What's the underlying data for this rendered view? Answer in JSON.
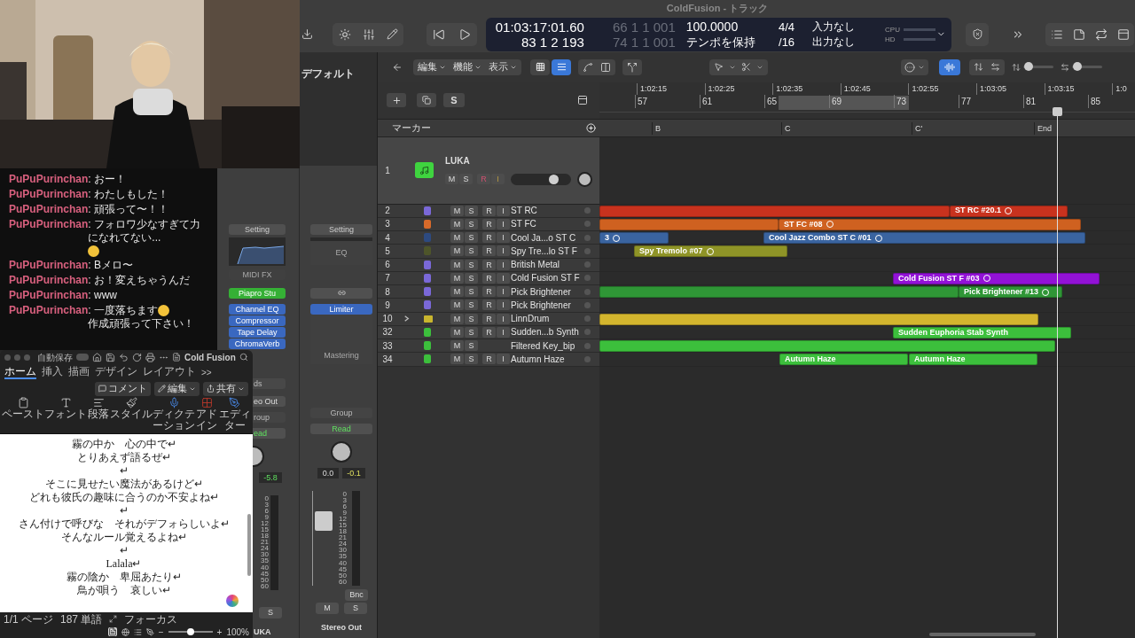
{
  "chat": {
    "messages": [
      {
        "user": "PuPuPurinchan",
        "parts": [
          {
            "kind": "text",
            "text": ": おー！"
          }
        ]
      },
      {
        "user": "PuPuPurinchan",
        "parts": [
          {
            "kind": "text",
            "text": ": わたしもした！"
          }
        ]
      },
      {
        "user": "PuPuPurinchan",
        "parts": [
          {
            "kind": "text",
            "text": ": 頑張って〜！！"
          }
        ]
      },
      {
        "user": "PuPuPurinchan",
        "parts": [
          {
            "kind": "text",
            "text": ": フォロワ少なすぎて力になれてない..."
          },
          {
            "kind": "emoji"
          }
        ]
      },
      {
        "user": "PuPuPurinchan",
        "parts": [
          {
            "kind": "text",
            "text": ": Bメロ〜"
          }
        ]
      },
      {
        "user": "PuPuPurinchan",
        "parts": [
          {
            "kind": "text",
            "text": ": お！変えちゃうんだ"
          }
        ]
      },
      {
        "user": "PuPuPurinchan",
        "parts": [
          {
            "kind": "text",
            "text": ": www"
          }
        ]
      },
      {
        "user": "PuPuPurinchan",
        "parts": [
          {
            "kind": "text",
            "text": ": 一度落ちます"
          },
          {
            "kind": "emoji"
          },
          {
            "kind": "text",
            "text": "作成頑張って下さい！"
          }
        ]
      }
    ]
  },
  "word": {
    "autosave": "自動保存",
    "autosave_toggle": {
      "on": false
    },
    "title": "Cold Fusion",
    "tabs": [
      {
        "label": "ホーム",
        "selected": true
      },
      {
        "label": "挿入",
        "selected": false
      },
      {
        "label": "描画",
        "selected": false
      },
      {
        "label": "デザイン",
        "selected": false
      },
      {
        "label": "レイアウト",
        "selected": false
      }
    ],
    "more": ">>",
    "actions": [
      "コメント",
      "編集",
      "共有"
    ],
    "ribbon": [
      "ペースト",
      "フォント",
      "段落",
      "スタイル",
      "ディクテーション",
      "アドイン",
      "エディター"
    ],
    "lines": [
      "霧の中か　心の中で↵",
      "とりあえず語るぜ↵",
      "↵",
      "そこに見せたい魔法があるけど↵",
      "どれも彼氏の趣味に合うのか不安よね↵",
      "↵",
      "さん付けで呼びな　それがデフォらしいよ↵",
      "そんなルール覚えるよね↵",
      "↵",
      "Lalala↵",
      "霧の陰か　卑屈あたり↵",
      "鳥が唄う　哀しい↵"
    ],
    "status": {
      "page": "1/1 ページ",
      "words": "187 単語",
      "focus": "フォーカス",
      "layouts": [
        {
          "selected": true
        },
        {
          "selected": false
        },
        {
          "selected": false
        },
        {
          "selected": false
        }
      ],
      "zoom_out": "−",
      "zoom_in": "+",
      "zoom": {
        "level": 0.5
      },
      "zoom_text": "100%"
    }
  },
  "logic": {
    "title": "ColdFusion - トラック",
    "lcd": {
      "time": "01:03:17:01.60",
      "position": "83 1 2 193",
      "ghost_1": "66 1 1 001",
      "ghost_2": "74 1 1 001",
      "tempo": "100.0000",
      "tempo_mode": "テンポを保持",
      "signature": "4/4",
      "division": "/16",
      "input": "入力なし",
      "output": "出力なし",
      "cpu": "CPU",
      "hd": "HD"
    },
    "inspector_title": "デフォルト",
    "menus": [
      "編集",
      "機能",
      "表示"
    ],
    "view_buttons": [
      {
        "selected": false
      },
      {
        "selected": true
      }
    ],
    "waveform_zoom": {
      "on": true
    },
    "vertical_zoom": {
      "level": 0.05
    },
    "horizontal_zoom": {
      "level": 0.05
    },
    "header_solo": "S",
    "marker_label": "マーカー",
    "ruler": {
      "times": [
        "1:02:15",
        "1:02:25",
        "1:02:35",
        "1:02:45",
        "1:02:55",
        "1:03:05",
        "1:03:15",
        "1:0"
      ],
      "bars": [
        "57",
        "61",
        "65",
        "69",
        "73",
        "77",
        "81",
        "85"
      ]
    },
    "markers": [
      "B",
      "C",
      "C'",
      "End"
    ],
    "tracks": [
      {
        "number": "1",
        "name": "LUKA",
        "kind": "main",
        "color": "#3fd43f",
        "buttons": [
          "M",
          "S",
          "R",
          "I"
        ],
        "level": 0.75
      },
      {
        "number": "2",
        "name": "ST RC",
        "kind": "track",
        "color": "#7a68d8",
        "buttons": [
          "M",
          "S",
          "R",
          "I"
        ],
        "regions": [
          {
            "color": "#c8321e",
            "looped": false
          },
          {
            "color": "#c8321e",
            "label": "ST RC #20.1",
            "looped": true
          }
        ]
      },
      {
        "number": "3",
        "name": "ST FC",
        "kind": "track",
        "color": "#d86a2a",
        "buttons": [
          "M",
          "S",
          "R",
          "I"
        ],
        "regions": [
          {
            "color": "#cf6120",
            "looped": false
          },
          {
            "color": "#cf6120",
            "label": "ST FC #08",
            "looped": true
          }
        ]
      },
      {
        "number": "4",
        "name": "Cool Ja...o ST C",
        "kind": "track",
        "color": "#2d4a80",
        "buttons": [
          "M",
          "S",
          "R",
          "I"
        ],
        "regions": [
          {
            "color": "#3a64a0",
            "label": "3",
            "looped": true
          },
          {
            "color": "#3a64a0",
            "label": "Cool Jazz Combo ST C #01",
            "looped": true
          }
        ]
      },
      {
        "number": "5",
        "name": "Spy Tre...lo ST F",
        "kind": "track",
        "color": "#4e552a",
        "buttons": [
          "M",
          "S",
          "R",
          "I"
        ],
        "regions": [
          {
            "color": "#8f9427",
            "label": "Spy Tremolo #07",
            "looped": true
          }
        ]
      },
      {
        "number": "6",
        "name": "British Metal",
        "kind": "track",
        "color": "#7a68d8",
        "buttons": [
          "M",
          "S",
          "R",
          "I"
        ]
      },
      {
        "number": "7",
        "name": "Cold Fusion ST F",
        "kind": "track",
        "color": "#7a68d8",
        "buttons": [
          "M",
          "S",
          "R",
          "I"
        ],
        "regions": [
          {
            "color": "#9212d6",
            "label": "Cold Fusion ST F #03",
            "looped": true
          }
        ]
      },
      {
        "number": "8",
        "name": "Pick Brightener",
        "kind": "track",
        "color": "#7a68d8",
        "buttons": [
          "M",
          "S",
          "R",
          "I"
        ],
        "regions": [
          {
            "color": "#2f9636",
            "looped": false
          },
          {
            "color": "#2f9636",
            "label": "Pick Brightener #13",
            "looped": true
          }
        ]
      },
      {
        "number": "9",
        "name": "Pick Brightener",
        "kind": "track",
        "color": "#7a68d8",
        "buttons": [
          "M",
          "S",
          "R",
          "I"
        ]
      },
      {
        "number": "10",
        "name": "LinnDrum",
        "kind": "stack",
        "expanded": false,
        "color": "#c8b52e",
        "buttons": [
          "M",
          "S",
          "R",
          "I"
        ],
        "regions": [
          {
            "color": "#d3b52e",
            "looped": false
          }
        ]
      },
      {
        "number": "32",
        "name": "Sudden...b Synth",
        "kind": "track",
        "color": "#3cbf3c",
        "buttons": [
          "M",
          "S",
          "R",
          "I"
        ],
        "regions": [
          {
            "color": "#3cbf3c",
            "label": "Sudden Euphoria Stab Synth",
            "looped": false
          }
        ]
      },
      {
        "number": "33",
        "name": "Filtered Key_bip",
        "kind": "track",
        "color": "#3cbf3c",
        "buttons": [
          "M",
          "S"
        ],
        "regions": [
          {
            "color": "#3cbf3c",
            "looped": false
          }
        ]
      },
      {
        "number": "34",
        "name": "Autumn Haze",
        "kind": "track",
        "color": "#3cbf3c",
        "buttons": [
          "M",
          "S",
          "R",
          "I"
        ],
        "regions": [
          {
            "color": "#3cbf3c",
            "label": "Autumn Haze",
            "looped": false
          },
          {
            "color": "#3cbf3c",
            "label": "Autumn Haze",
            "looped": false
          }
        ]
      }
    ],
    "mixer": {
      "strip_1": {
        "setting": "Setting",
        "midi_fx": "MIDI FX",
        "instrument": "Piapro Stu",
        "plugins": [
          "Channel EQ",
          "Compressor",
          "Tape Delay",
          "ChromaVerb"
        ],
        "sends": "ds",
        "output": "eo Out",
        "group": "roup",
        "automation": "ead",
        "peak": "-5.8",
        "meter_scale": [
          "0",
          "3",
          "6",
          "9",
          "12",
          "15",
          "18",
          "21",
          "24",
          "30",
          "35",
          "40",
          "45",
          "50",
          "60"
        ],
        "solo": "S",
        "name": "UKA"
      },
      "strip_2": {
        "setting": "Setting",
        "eq": "EQ",
        "plugins": [
          "Limiter"
        ],
        "slot_label": "Mastering",
        "group": "Group",
        "automation": "Read",
        "volume": "0.0",
        "peak": "-0.1",
        "fader": {
          "level": 0.72
        },
        "meter_scale": [
          "0",
          "3",
          "6",
          "9",
          "12",
          "15",
          "18",
          "21",
          "24",
          "30",
          "35",
          "40",
          "45",
          "50",
          "60"
        ],
        "bounce": "Bnc",
        "mute": "M",
        "solo": "S",
        "name": "Stereo Out"
      }
    }
  }
}
